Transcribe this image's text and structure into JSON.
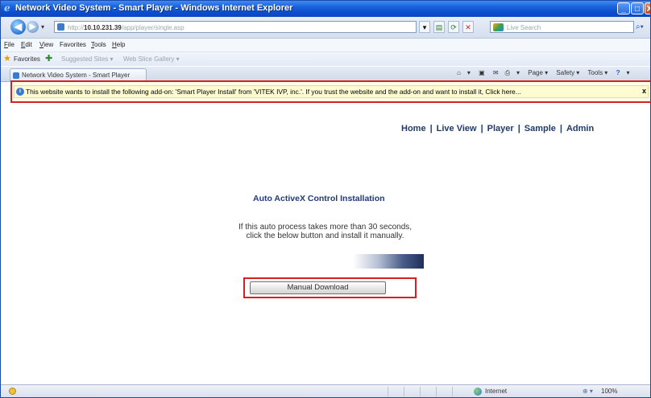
{
  "window": {
    "title": "Network Video System - Smart Player - Windows Internet Explorer",
    "controls": {
      "minimize": "_",
      "maximize": "□",
      "close": "X"
    }
  },
  "address_bar": {
    "url_prefix": "http://",
    "url_host": "10.10.231.39",
    "url_path": "/app/player/single.asp",
    "search_placeholder": "Live Search",
    "refresh": "⟳",
    "stop": "✕"
  },
  "menu": {
    "items": [
      {
        "key": "F",
        "rest": "ile"
      },
      {
        "key": "E",
        "rest": "dit"
      },
      {
        "key": "V",
        "rest": "iew"
      },
      {
        "key": "",
        "rest": "Favorites"
      },
      {
        "key": "T",
        "rest": "ools"
      },
      {
        "key": "H",
        "rest": "elp"
      }
    ]
  },
  "favorites_bar": {
    "label": "Favorites",
    "suggested_sites": "Suggested Sites ▾",
    "web_slice_gallery": "Web Slice Gallery ▾"
  },
  "tab": {
    "title": "Network Video System - Smart Player"
  },
  "command_bar": {
    "items": [
      "▾",
      "▾",
      "Page ▾",
      "Safety ▾",
      "Tools ▾",
      "▾"
    ]
  },
  "info_bar": {
    "message": "This website wants to install the following add-on: 'Smart Player Install' from 'VITEK IVP, inc.'. If you trust the website and the add-on and want to install it, Click here...",
    "close": "x"
  },
  "page": {
    "nav": [
      "Home",
      "Live View",
      "Player",
      "Sample",
      "Admin"
    ],
    "nav_separator": "|",
    "heading": "Auto ActiveX Control Installation",
    "description_line1": "If this auto process takes more than 30 seconds,",
    "description_line2": "click the below button and install it manually.",
    "download_button": "Manual Download"
  },
  "status_bar": {
    "zone": "Internet",
    "zoom": "100%"
  }
}
